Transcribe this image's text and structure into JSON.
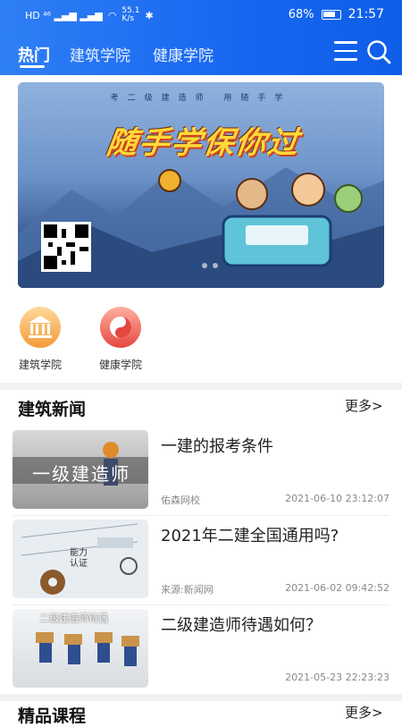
{
  "status": {
    "net_speed": "55.1\nK/s",
    "battery": "68%",
    "time": "21:57"
  },
  "tabs": [
    "热门",
    "建筑学院",
    "健康学院"
  ],
  "banner": {
    "caption": "考二级建造师  用随手学",
    "slogan": "随手学保你过"
  },
  "categories": [
    {
      "label": "建筑学院",
      "icon": "building-icon"
    },
    {
      "label": "健康学院",
      "icon": "taiji-icon"
    }
  ],
  "news_section": {
    "title": "建筑新闻",
    "more": "更多>"
  },
  "news": [
    {
      "title": "一建的报考条件",
      "source": "佑森网校",
      "time": "2021-06-10 23:12:07",
      "thumb_text": "一级建造师"
    },
    {
      "title": "2021年二建全国通用吗?",
      "source": "来源:新闻网",
      "time": "2021-06-02 09:42:52",
      "thumb_text": "能力\n认证"
    },
    {
      "title": "二级建造师待遇如何？",
      "source": "",
      "time": "2021-05-23 22:23:23",
      "thumb_text": "二级建造师待遇"
    }
  ],
  "courses_section": {
    "title": "精品课程",
    "more": "更多>"
  },
  "colors": {
    "header_blue": "#1766f0",
    "category_orange": "#f39a3a",
    "category_red": "#e5473f"
  }
}
